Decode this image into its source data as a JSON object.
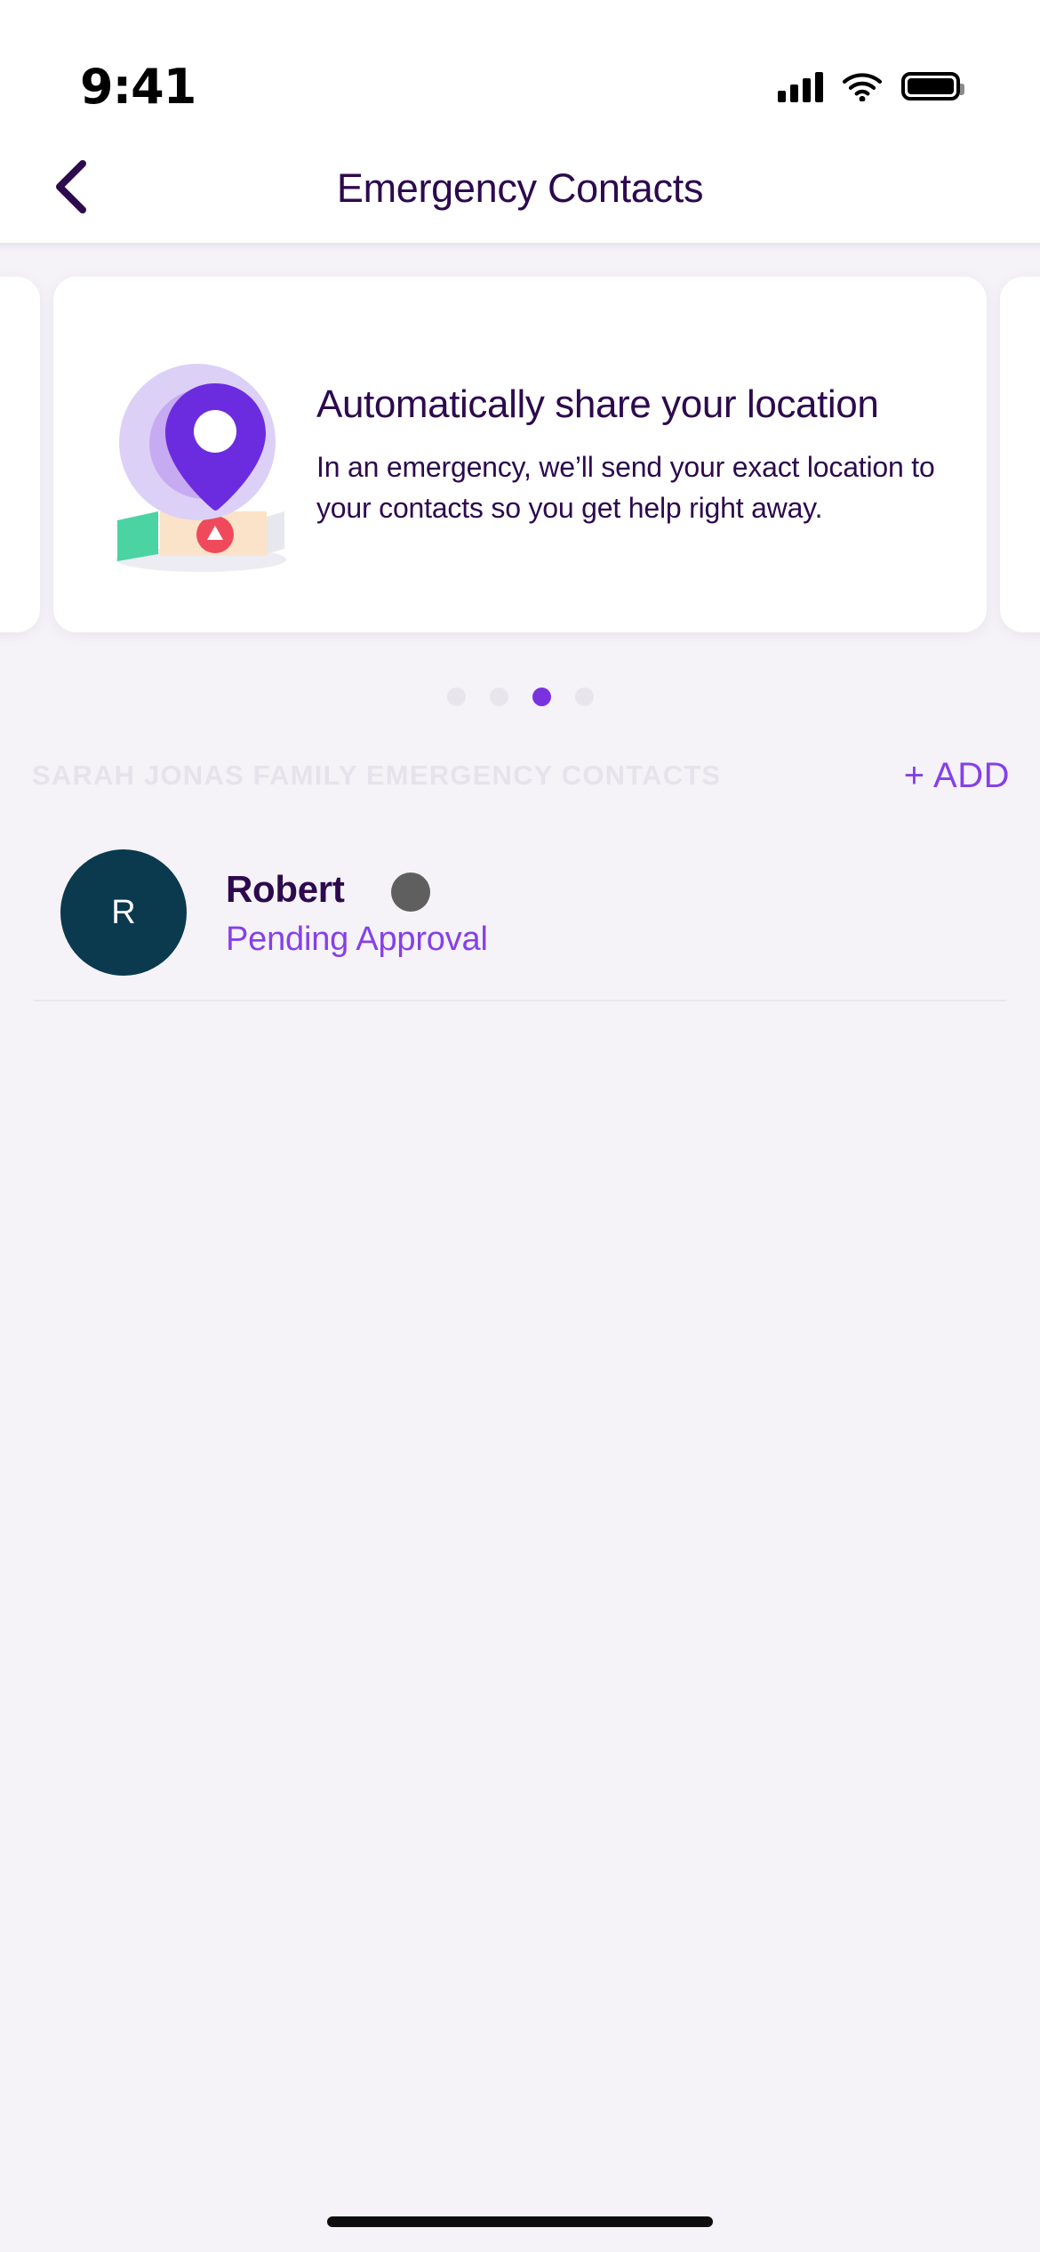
{
  "status_bar": {
    "time": "9:41",
    "cellular_icon": "cellular-signal-icon",
    "wifi_icon": "wifi-icon",
    "battery_icon": "battery-full-icon"
  },
  "nav": {
    "back_icon": "chevron-left-icon",
    "title": "Emergency Contacts"
  },
  "carousel": {
    "card": {
      "illustration": "location-pin-map-icon",
      "heading": "Automatically share your location",
      "body": "In an emergency, we’ll send your exact location to your contacts so you get help right away."
    },
    "dots": {
      "count": 4,
      "active_index": 2,
      "active_color": "#7a32e0",
      "inactive_color": "#e8e5ed"
    }
  },
  "section": {
    "title": "SARAH JONAS FAMILY EMERGENCY CONTACTS",
    "add_label": "+ ADD",
    "add_color": "#8640e8"
  },
  "contacts": [
    {
      "initial": "R",
      "avatar_color": "#0b3a4f",
      "name": "Robert",
      "status": "Pending Approval",
      "status_color": "#8640e8",
      "status_dot_color": "#5f5f5f"
    }
  ],
  "theme": {
    "background": "#f5f3f8",
    "card_background": "#ffffff",
    "primary_text": "#2d0a4e",
    "accent": "#7a32e0"
  },
  "home_indicator": "home-indicator-bar"
}
